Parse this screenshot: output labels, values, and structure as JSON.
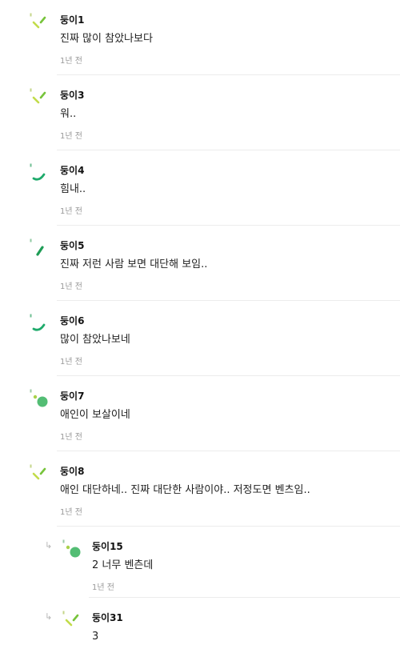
{
  "comments": [
    {
      "name": "둥이1",
      "text": "진짜 많이 참았나보다",
      "time": "1년 전",
      "avatar": "lime-dashes-icon",
      "reply": false
    },
    {
      "name": "둥이3",
      "text": "워..",
      "time": "1년 전",
      "avatar": "lime-dashes-icon",
      "reply": false
    },
    {
      "name": "둥이4",
      "text": "힘내..",
      "time": "1년 전",
      "avatar": "green-arc-icon",
      "reply": false
    },
    {
      "name": "둥이5",
      "text": "진짜 저런 사람 보면 대단해 보임..",
      "time": "1년 전",
      "avatar": "green-slash-icon",
      "reply": false
    },
    {
      "name": "둥이6",
      "text": "많이 참았나보네",
      "time": "1년 전",
      "avatar": "green-arc-icon",
      "reply": false
    },
    {
      "name": "둥이7",
      "text": "애인이 보살이네",
      "time": "1년 전",
      "avatar": "green-dots-icon",
      "reply": false
    },
    {
      "name": "둥이8",
      "text": "애인 대단하네.. 진짜 대단한 사람이야.. 저정도면 벤츠임..",
      "time": "1년 전",
      "avatar": "lime-dashes-icon",
      "reply": false
    },
    {
      "name": "둥이15",
      "text": "2 너무 벤츤데",
      "time": "1년 전",
      "avatar": "green-dots-icon",
      "reply": true
    },
    {
      "name": "둥이31",
      "text": "3",
      "time": "",
      "avatar": "lime-dashes-icon",
      "reply": true
    }
  ],
  "reply_arrow_icon": "reply-arrow-icon"
}
